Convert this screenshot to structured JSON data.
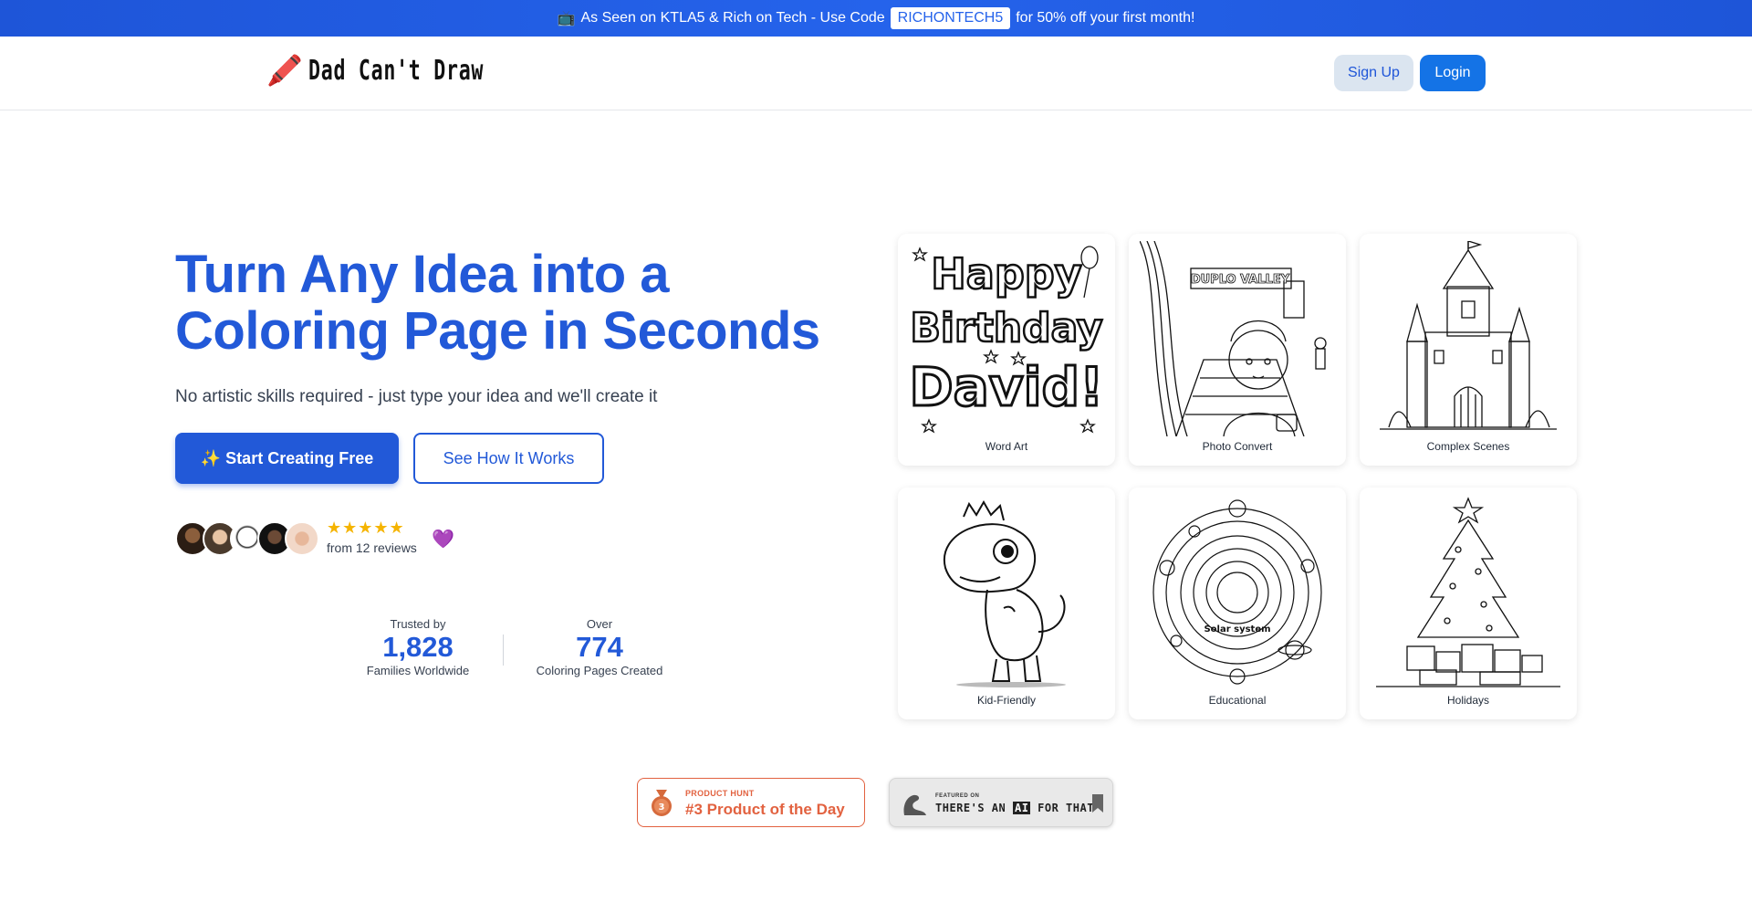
{
  "promo": {
    "icon": "tv-icon",
    "text_before": "As Seen on KTLA5 & Rich on Tech - Use Code",
    "code": "RICHONTECH5",
    "text_after": "for 50% off your first month!"
  },
  "header": {
    "logo_icon": "crayon-icon",
    "logo_text": "Dad Can't Draw",
    "signup_label": "Sign Up",
    "login_label": "Login"
  },
  "hero": {
    "title_line1": "Turn Any Idea into a",
    "title_line2": "Coloring Page in Seconds",
    "subtitle": "No artistic skills required - just type your idea and we'll create it",
    "start_label": "✨ Start Creating Free",
    "how_label": "See How It Works",
    "rating_stars": 5,
    "reviews_text": "from 12 reviews"
  },
  "stats": [
    {
      "label_top": "Trusted by",
      "value": "1,828",
      "label_bottom": "Families Worldwide"
    },
    {
      "label_top": "Over",
      "value": "774",
      "label_bottom": "Coloring Pages Created"
    }
  ],
  "gallery": [
    {
      "caption": "Word Art",
      "art_text_1": "Happy",
      "art_text_2": "Birthday",
      "art_text_3": "David!"
    },
    {
      "caption": "Photo Convert",
      "art_text_1": "DUPLO VALLEY"
    },
    {
      "caption": "Complex Scenes"
    },
    {
      "caption": "Kid-Friendly"
    },
    {
      "caption": "Educational",
      "art_text_1": "Solar system"
    },
    {
      "caption": "Holidays"
    }
  ],
  "badges": {
    "producthunt_small": "PRODUCT HUNT",
    "producthunt_big": "#3 Product of the Day",
    "medal_number": "3",
    "aiforthat_small": "FEATURED ON",
    "aiforthat_pre": "THERE'S AN ",
    "aiforthat_ai": "AI",
    "aiforthat_post": " FOR THAT"
  },
  "colors": {
    "brand_blue": "#2259d8",
    "login_blue": "#1473e6",
    "star_gold": "#f5b400",
    "producthunt_orange": "#e26240",
    "heart_purple": "#7c3aed"
  }
}
